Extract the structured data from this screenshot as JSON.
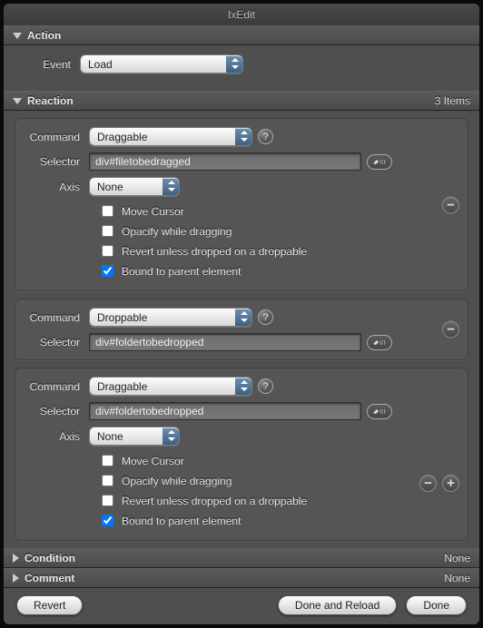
{
  "window": {
    "title": "IxEdit"
  },
  "sections": {
    "action": {
      "title": "Action",
      "expanded": true
    },
    "reaction": {
      "title": "Reaction",
      "expanded": true,
      "count_label": "3 Items"
    },
    "condition": {
      "title": "Condition",
      "expanded": false,
      "status": "None"
    },
    "comment": {
      "title": "Comment",
      "expanded": false,
      "status": "None"
    }
  },
  "labels": {
    "event": "Event",
    "command": "Command",
    "selector": "Selector",
    "axis": "Axis",
    "help": "?"
  },
  "action": {
    "event": "Load"
  },
  "reactions": [
    {
      "command": "Draggable",
      "selector": "div#filetobedragged",
      "axis": "None",
      "opts": {
        "move_cursor": {
          "label": "Move Cursor",
          "checked": false
        },
        "opacify": {
          "label": "Opacify while dragging",
          "checked": false
        },
        "revert": {
          "label": "Revert unless dropped on a droppable",
          "checked": false
        },
        "bound": {
          "label": "Bound to parent element",
          "checked": true
        }
      }
    },
    {
      "command": "Droppable",
      "selector": "div#foldertobedropped"
    },
    {
      "command": "Draggable",
      "selector": "div#foldertobedropped",
      "axis": "None",
      "opts": {
        "move_cursor": {
          "label": "Move Cursor",
          "checked": false
        },
        "opacify": {
          "label": "Opacify while dragging",
          "checked": false
        },
        "revert": {
          "label": "Revert unless dropped on a droppable",
          "checked": false
        },
        "bound": {
          "label": "Bound to parent element",
          "checked": true
        }
      }
    }
  ],
  "footer": {
    "revert": "Revert",
    "done_reload": "Done and Reload",
    "done": "Done"
  }
}
